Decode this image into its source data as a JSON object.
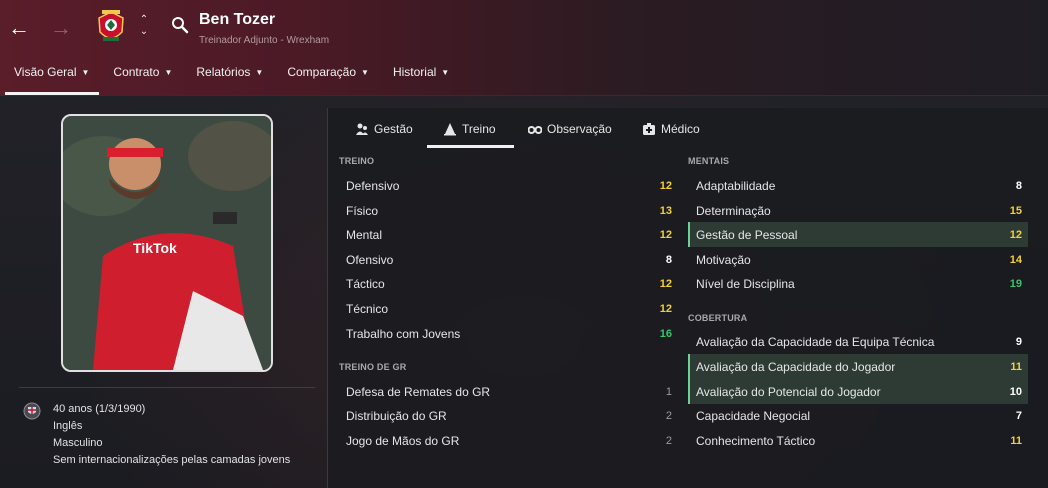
{
  "header": {
    "title": "Ben Tozer",
    "subtitle": "Treinador Adjunto - Wrexham",
    "tabs": [
      {
        "label": "Visão Geral"
      },
      {
        "label": "Contrato"
      },
      {
        "label": "Relatórios"
      },
      {
        "label": "Comparação"
      },
      {
        "label": "Historial"
      }
    ]
  },
  "profile": {
    "age": "40 anos (1/3/1990)",
    "nationality": "Inglês",
    "gender": "Masculino",
    "youth_caps": "Sem internacionalizações pelas camadas jovens"
  },
  "panel": {
    "tabs": [
      {
        "label": "Gestão",
        "icon": "people-icon"
      },
      {
        "label": "Treino",
        "icon": "cone-icon"
      },
      {
        "label": "Observação",
        "icon": "binoculars-icon"
      },
      {
        "label": "Médico",
        "icon": "medical-kit-icon"
      }
    ],
    "treino": {
      "heading": "TREINO",
      "rows": [
        {
          "label": "Defensivo",
          "value": "12"
        },
        {
          "label": "Físico",
          "value": "13"
        },
        {
          "label": "Mental",
          "value": "12"
        },
        {
          "label": "Ofensivo",
          "value": "8"
        },
        {
          "label": "Táctico",
          "value": "12"
        },
        {
          "label": "Técnico",
          "value": "12"
        },
        {
          "label": "Trabalho com Jovens",
          "value": "16"
        }
      ]
    },
    "treino_gr": {
      "heading": "TREINO DE GR",
      "rows": [
        {
          "label": "Defesa de Remates do GR",
          "value": "1"
        },
        {
          "label": "Distribuição do GR",
          "value": "2"
        },
        {
          "label": "Jogo de Mãos do GR",
          "value": "2"
        }
      ]
    },
    "mentais": {
      "heading": "MENTAIS",
      "rows": [
        {
          "label": "Adaptabilidade",
          "value": "8"
        },
        {
          "label": "Determinação",
          "value": "15"
        },
        {
          "label": "Gestão de Pessoal",
          "value": "12"
        },
        {
          "label": "Motivação",
          "value": "14"
        },
        {
          "label": "Nível de Disciplina",
          "value": "19"
        }
      ]
    },
    "cobertura": {
      "heading": "COBERTURA",
      "rows": [
        {
          "label": "Avaliação da Capacidade da Equipa Técnica",
          "value": "9"
        },
        {
          "label": "Avaliação da Capacidade do Jogador",
          "value": "11"
        },
        {
          "label": "Avaliação do Potencial do Jogador",
          "value": "10"
        },
        {
          "label": "Capacidade Negocial",
          "value": "7"
        },
        {
          "label": "Conhecimento Táctico",
          "value": "11"
        }
      ]
    }
  },
  "colors": {
    "accent_yellow": "#f2d03b",
    "accent_green": "#37c46b",
    "highlight_bg": "#2d3b34",
    "header_maroon": "#5a1d2a"
  }
}
